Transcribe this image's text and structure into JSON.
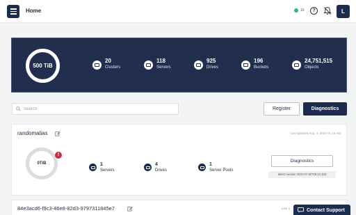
{
  "header": {
    "title": "Home",
    "health_count": "16",
    "help_label": "?",
    "avatar_initial": "L"
  },
  "banner": {
    "capacity": "500 TiB",
    "stats": [
      {
        "value": "20",
        "label": "Clusters",
        "icon": "cluster-icon"
      },
      {
        "value": "118",
        "label": "Servers",
        "icon": "server-icon"
      },
      {
        "value": "925",
        "label": "Drives",
        "icon": "drive-icon"
      },
      {
        "value": "196",
        "label": "Buckets",
        "icon": "bucket-icon"
      },
      {
        "value": "24,751,515",
        "label": "Objects",
        "icon": "object-icon"
      }
    ]
  },
  "toolbar": {
    "search_placeholder": "Search",
    "register_label": "Register",
    "diagnostics_label": "Diagnostics"
  },
  "servers": [
    {
      "name": "randomalias",
      "last_updated": "Last updated Aug. 4, 2022 01:19 AM",
      "usage": "0TiB",
      "alert": "!",
      "servers": {
        "value": "1",
        "label": "Servers"
      },
      "drives": {
        "value": "4",
        "label": "Drives"
      },
      "pools": {
        "value": "1",
        "label": "Server Pools"
      },
      "diagnostics_label": "Diagnostics",
      "version": "MinIO version 2022-07-30T05:21:40Z"
    },
    {
      "name": "84e3acd6-f9c3-46e8-82d3-9797311845e7",
      "last_updated": "Last u"
    }
  ],
  "contact": {
    "label": "Contact Support"
  },
  "colors": {
    "navy": "#1c2c4f",
    "banner": "#222e4d",
    "health": "#2eb88a",
    "alert": "#c72c48"
  }
}
